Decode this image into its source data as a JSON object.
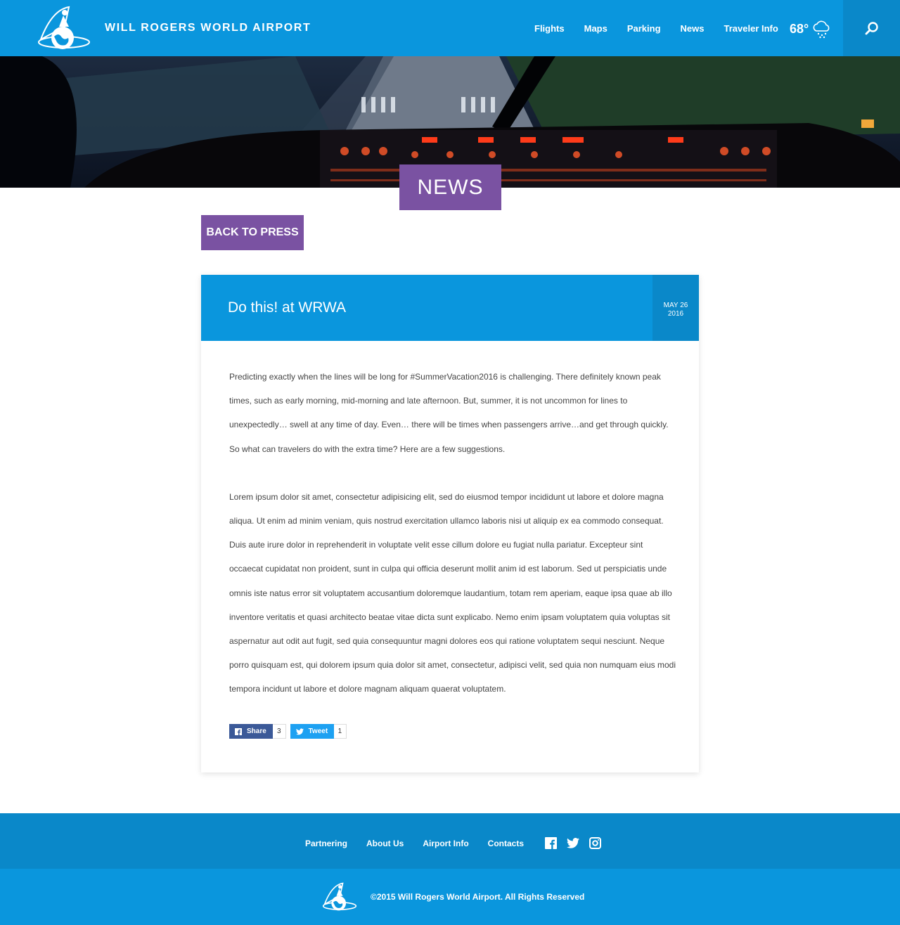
{
  "header": {
    "brand": "WILL ROGERS WORLD AIRPORT",
    "nav": [
      {
        "label": "Flights"
      },
      {
        "label": "Maps"
      },
      {
        "label": "Parking"
      },
      {
        "label": "News"
      },
      {
        "label": "Traveler Info"
      }
    ],
    "weather": {
      "temp": "68°",
      "icon": "snow-cloud-icon"
    },
    "search_icon": "search-icon"
  },
  "hero": {
    "label": "NEWS"
  },
  "back_button": "BACK TO PRESS",
  "article": {
    "title": "Do this! at WRWA",
    "date_month_day": "MAY 26",
    "date_year": "2016",
    "paragraphs": [
      "Predicting exactly when the lines will be long for #SummerVacation2016 is challenging.  There definitely known peak times, such as early morning, mid-morning and late afternoon. But, summer, it is not uncommon for lines to unexpectedly… swell at any time of day.  Even… there will be times when passengers arrive…and get through quickly.  So what can travelers do with the extra time? Here are a few suggestions.",
      "Lorem ipsum dolor sit amet, consectetur adipisicing elit, sed do eiusmod tempor incididunt ut labore et dolore magna aliqua. Ut enim ad minim veniam, quis nostrud exercitation ullamco laboris nisi ut aliquip ex ea commodo consequat. Duis aute irure dolor in reprehenderit in voluptate velit esse cillum dolore eu fugiat nulla pariatur. Excepteur sint occaecat cupidatat non proident, sunt in culpa qui officia deserunt mollit anim id est laborum. Sed ut perspiciatis unde omnis iste natus error sit voluptatem accusantium doloremque laudantium, totam rem aperiam, eaque ipsa quae ab illo inventore veritatis et quasi architecto beatae vitae dicta sunt explicabo. Nemo enim ipsam voluptatem quia voluptas sit aspernatur aut odit aut fugit, sed quia consequuntur magni dolores eos qui ratione voluptatem sequi nesciunt. Neque porro quisquam est, qui dolorem ipsum quia dolor sit amet, consectetur, adipisci velit, sed quia non numquam eius modi tempora incidunt ut labore et dolore magnam aliquam quaerat voluptatem."
    ],
    "share": {
      "facebook_label": "Share",
      "facebook_count": "3",
      "twitter_label": "Tweet",
      "twitter_count": "1"
    }
  },
  "footer": {
    "nav": [
      {
        "label": "Partnering"
      },
      {
        "label": "About Us"
      },
      {
        "label": "Airport Info"
      },
      {
        "label": "Contacts"
      }
    ],
    "social": [
      "facebook-icon",
      "twitter-icon",
      "instagram-icon"
    ],
    "copyright": "©2015 Will Rogers World Airport. All Rights Reserved"
  },
  "colors": {
    "primary_blue": "#0a96dd",
    "dark_blue": "#0a88c9",
    "purple": "#7a52a2",
    "facebook": "#3b5998",
    "twitter": "#1da1f2"
  }
}
